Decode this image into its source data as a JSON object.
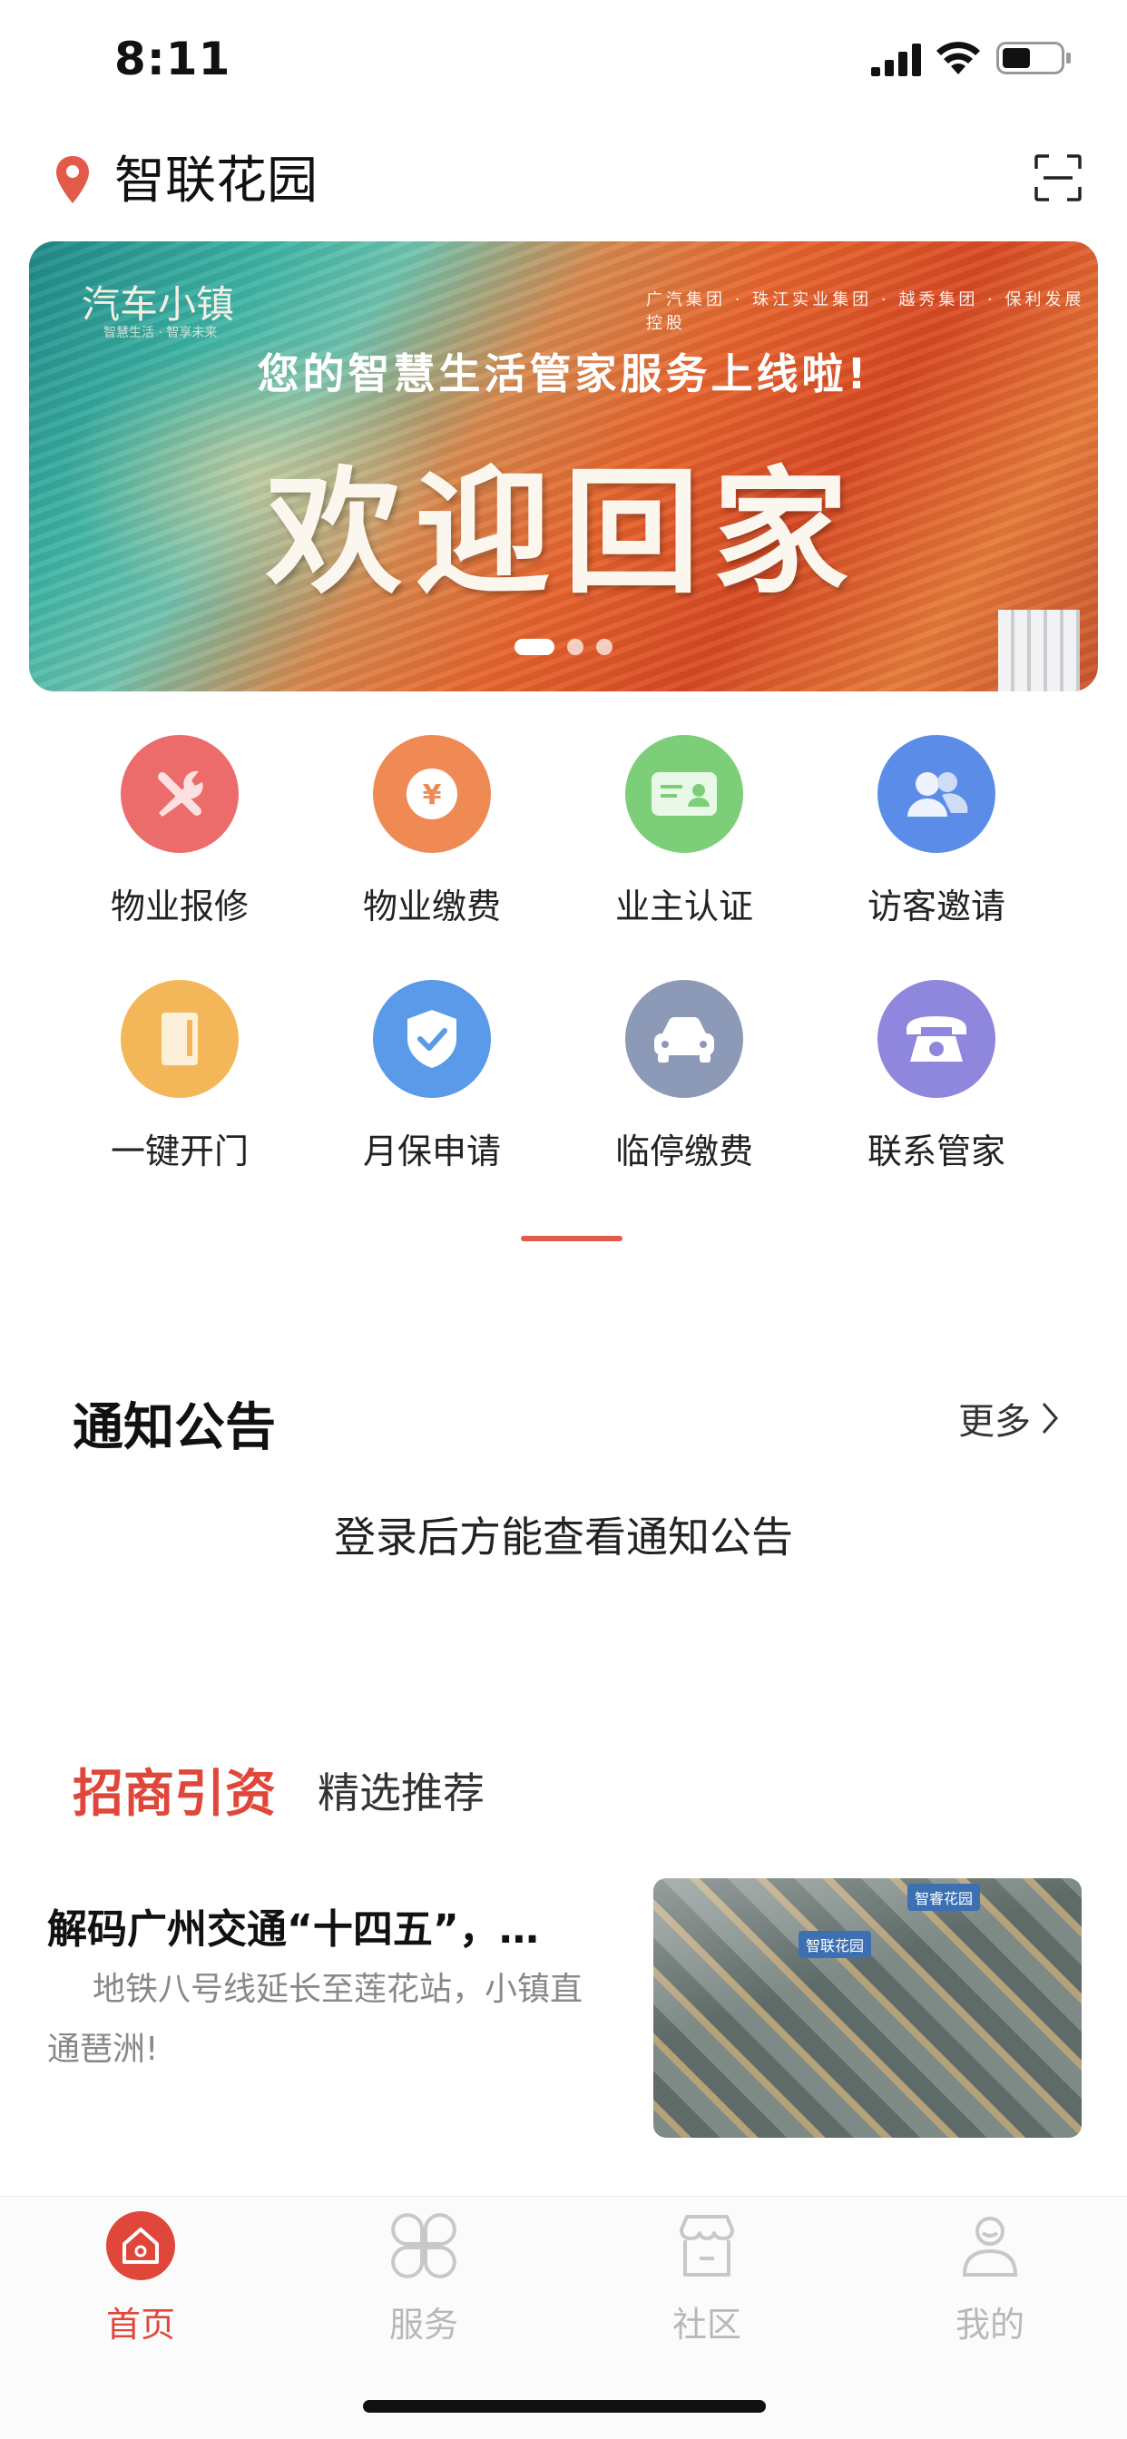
{
  "status_bar": {
    "time": "8:11"
  },
  "header": {
    "location": "智联花园"
  },
  "banner": {
    "brand": "汽车小镇",
    "brand_sub": "智慧生活 · 智享未来",
    "partners": "广汽集团 · 珠江实业集团 · 越秀集团 · 保利发展控股",
    "tagline": "您的智慧生活管家服务上线啦!",
    "title": "欢迎回家",
    "page_count": 3,
    "active_page": 1
  },
  "services": [
    {
      "label": "物业报修",
      "icon": "wrench-icon",
      "color": "#ec6b6b"
    },
    {
      "label": "物业缴费",
      "icon": "yen-icon",
      "color": "#ef8a55"
    },
    {
      "label": "业主认证",
      "icon": "id-card-icon",
      "color": "#7ccf78"
    },
    {
      "label": "访客邀请",
      "icon": "people-icon",
      "color": "#5b8de8"
    },
    {
      "label": "一键开门",
      "icon": "door-icon",
      "color": "#f3b75a"
    },
    {
      "label": "月保申请",
      "icon": "shield-icon",
      "color": "#5a9ae8"
    },
    {
      "label": "临停缴费",
      "icon": "car-icon",
      "color": "#8c9ab8"
    },
    {
      "label": "联系管家",
      "icon": "phone-icon",
      "color": "#8f86dd"
    }
  ],
  "notices": {
    "title": "通知公告",
    "more": "更多",
    "empty_text": "登录后方能查看通知公告"
  },
  "recommend": {
    "title": "招商引资",
    "subtitle": "精选推荐",
    "article": {
      "title": "解码广州交通“十四五”，…",
      "desc": "地铁八号线延长至莲花站，小镇直通琶洲!",
      "image_tags": [
        "智睿花园",
        "智联花园"
      ]
    }
  },
  "tabbar": {
    "items": [
      {
        "label": "首页",
        "icon": "home-icon",
        "active": true
      },
      {
        "label": "服务",
        "icon": "grid-icon",
        "active": false
      },
      {
        "label": "社区",
        "icon": "store-icon",
        "active": false
      },
      {
        "label": "我的",
        "icon": "user-icon",
        "active": false
      }
    ]
  },
  "colors": {
    "accent": "#e0473a"
  }
}
